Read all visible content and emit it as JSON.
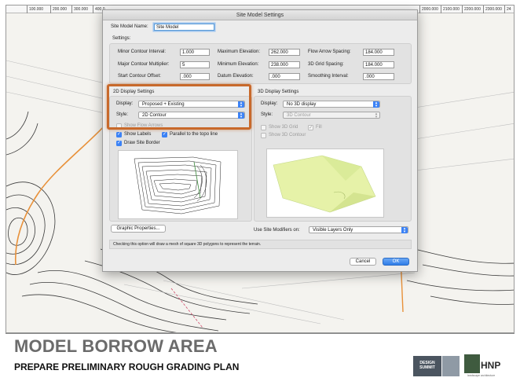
{
  "ruler": {
    "ticks": [
      "100.000",
      "200.000",
      "300.000",
      "400.0",
      "2000.000",
      "2100.000",
      "2200.000",
      "2300.000",
      "24"
    ]
  },
  "dialog": {
    "title": "Site Model Settings",
    "site_model_name_label": "Site Model Name:",
    "site_model_name_value": "Site Model",
    "settings_label": "Settings:",
    "fields": {
      "minor_contour_interval": {
        "label": "Minor Contour Interval:",
        "value": "1.000"
      },
      "major_contour_multiplier": {
        "label": "Major Contour Multiplier:",
        "value": "5"
      },
      "start_contour_offset": {
        "label": "Start Contour Offset:",
        "value": ".000"
      },
      "maximum_elevation": {
        "label": "Maximum Elevation:",
        "value": "262.000"
      },
      "minimum_elevation": {
        "label": "Minimum Elevation:",
        "value": "238.000"
      },
      "datum_elevation": {
        "label": "Datum Elevation:",
        "value": ".000"
      },
      "flow_arrow_spacing": {
        "label": "Flow Arrow Spacing:",
        "value": "184.000"
      },
      "grid_spacing_3d": {
        "label": "3D Grid Spacing:",
        "value": "184.000"
      },
      "smoothing_interval": {
        "label": "Smoothing Interval:",
        "value": ".000"
      }
    },
    "display_2d": {
      "title": "2D Display Settings",
      "display_label": "Display:",
      "display_value": "Proposed + Existing",
      "style_label": "Style:",
      "style_value": "2D Contour",
      "show_flow_arrows": "Show Flow Arrows",
      "show_labels": "Show Labels",
      "parallel_label": "Parallel to the topo line",
      "draw_site_border": "Draw Site Border"
    },
    "display_3d": {
      "title": "3D Display Settings",
      "display_label": "Display:",
      "display_value": "No 3D display",
      "style_label": "Style:",
      "style_value": "3D Contour",
      "show_3d_grid": "Show 3D Grid",
      "fill": "Fill",
      "show_3d_contour": "Show 3D Contour"
    },
    "graphic_properties": "Graphic Properties...",
    "use_site_modifiers_label": "Use Site Modifiers on:",
    "use_site_modifiers_value": "Visible Layers Only",
    "help_text": "Checking this option will draw a mesh of square 3D polygons to represent the terrain.",
    "cancel": "Cancel",
    "ok": "OK"
  },
  "footer": {
    "title": "MODEL BORROW AREA",
    "subtitle": "PREPARE PRELIMINARY ROUGH GRADING PLAN",
    "summit_logo": "DESIGN SUMMIT",
    "hnp_logo": "HNP",
    "hnp_sub": "landscape architecture"
  },
  "colors": {
    "highlight": "#c8692b",
    "accent": "#3b82f6",
    "footer_title": "#6b6b6b"
  }
}
